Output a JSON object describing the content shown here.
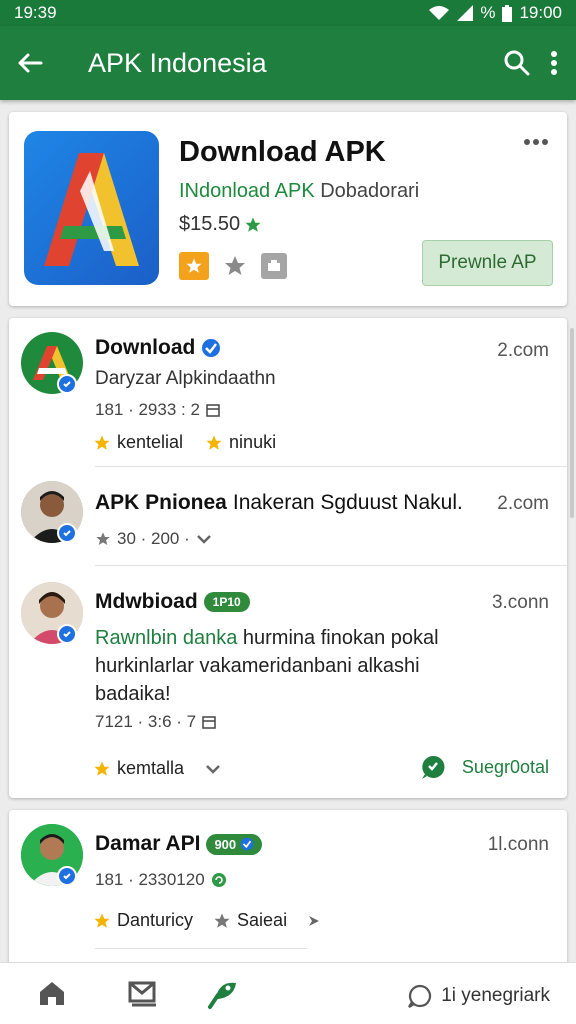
{
  "status_bar": {
    "time_left": "19:39",
    "battery_text": "%",
    "time_right": "19:00"
  },
  "app_bar": {
    "title": "APK Indonesia",
    "icons": [
      "back-arrow-icon",
      "search-icon",
      "more-vertical-icon"
    ]
  },
  "app_card": {
    "title": "Download APK",
    "subtitle_green": "INdonload APK",
    "subtitle_gray": "Dobadorari",
    "price": "$15.50",
    "preview_button": "Prewnle AP"
  },
  "posts": [
    {
      "name": "Download",
      "time": "2.com",
      "line": "Daryzar Alpkindaathn",
      "meta": "181 · 2933 : 2",
      "action1": "kentelial",
      "action2": "ninuki"
    },
    {
      "name": "APK Pnionea",
      "name_rest": "Inakeran Sgduust Nakul.",
      "time": "2.com",
      "meta": "30 · 200 ·"
    },
    {
      "name": "Mdwbioad",
      "tag": "1P10",
      "time": "3.conn",
      "body_green": "Rawnlbin danka",
      "body_1": " hurmina finokan pokal",
      "body_2": "hurkinlarlar vakameridanbani alkashi",
      "body_3": "badaika!",
      "meta": "7121 · 3:6 · 7",
      "action1": "kemtalla",
      "suggest": "Suegr0otal"
    },
    {
      "name": "Damar API",
      "tag": "900",
      "time": "1l.conn",
      "meta": "181 · 2330120",
      "action1": "Danturicy",
      "action2": "Saieai"
    }
  ],
  "bottom_nav": {
    "right_label": "1i yenegriark"
  },
  "colors": {
    "primary": "#1e7f3e",
    "accent_blue": "#1e6fe0",
    "star": "#f4b400"
  }
}
